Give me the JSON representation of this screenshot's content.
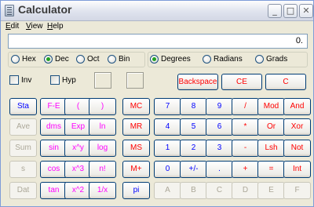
{
  "window": {
    "title": "Calculator",
    "controls": {
      "minimize": "_",
      "maximize": "□",
      "close": "✕"
    }
  },
  "menu": [
    {
      "label": "Edit",
      "mnemonic": "E",
      "rest": "dit"
    },
    {
      "label": "View",
      "mnemonic": "V",
      "rest": "iew"
    },
    {
      "label": "Help",
      "mnemonic": "H",
      "rest": "elp"
    }
  ],
  "display": {
    "value": "0."
  },
  "number_system": {
    "options": [
      "Hex",
      "Dec",
      "Oct",
      "Bin"
    ],
    "selected": "Dec"
  },
  "angle_units": {
    "options": [
      "Degrees",
      "Radians",
      "Grads"
    ],
    "selected": "Degrees"
  },
  "modifiers": {
    "inv": "Inv",
    "hyp": "Hyp"
  },
  "colors": {
    "window_bg": "#ece9d8",
    "button_border": "#003c74",
    "digit": "#0000ff",
    "operator": "#ff0000",
    "function": "#ff00ff",
    "disabled": "#aca899"
  },
  "buttons": {
    "backspace": "Backspace",
    "ce": "CE",
    "c": "C",
    "stats": [
      "Sta",
      "Ave",
      "Sum",
      "s",
      "Dat"
    ],
    "functions": [
      [
        "F-E",
        "(",
        ")"
      ],
      [
        "dms",
        "Exp",
        "ln"
      ],
      [
        "sin",
        "x^y",
        "log"
      ],
      [
        "cos",
        "x^3",
        "n!"
      ],
      [
        "tan",
        "x^2",
        "1/x"
      ]
    ],
    "memory": [
      "MC",
      "MR",
      "MS",
      "M+",
      "pi"
    ],
    "keypad": [
      [
        "7",
        "8",
        "9",
        "/",
        "Mod",
        "And"
      ],
      [
        "4",
        "5",
        "6",
        "*",
        "Or",
        "Xor"
      ],
      [
        "1",
        "2",
        "3",
        "-",
        "Lsh",
        "Not"
      ],
      [
        "0",
        "+/-",
        ".",
        "+",
        "=",
        "Int"
      ],
      [
        "A",
        "B",
        "C",
        "D",
        "E",
        "F"
      ]
    ]
  }
}
